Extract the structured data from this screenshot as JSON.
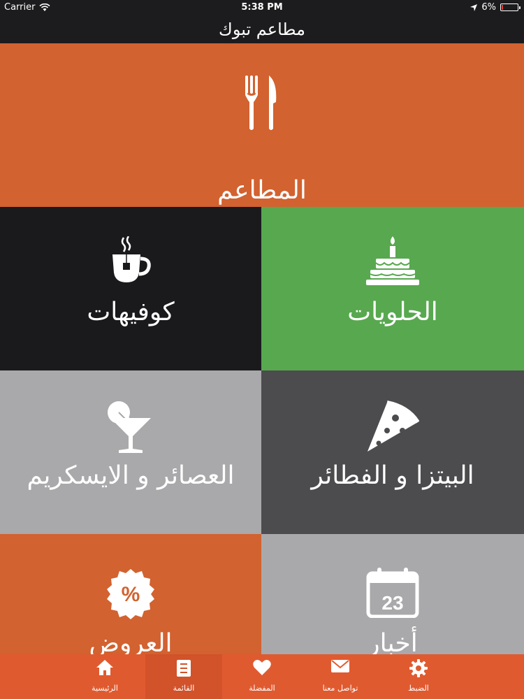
{
  "status_bar": {
    "carrier": "Carrier",
    "time": "5:38 PM",
    "battery": "6%",
    "battery_level": 0.06
  },
  "navbar": {
    "title": "مطاعم تبوك"
  },
  "tiles": {
    "restaurants": {
      "label": "المطاعم",
      "icon": "fork-knife-icon"
    },
    "cafes": {
      "label": "كوفيهات",
      "icon": "tea-cup-icon"
    },
    "sweets": {
      "label": "الحلويات",
      "icon": "cake-icon"
    },
    "juices": {
      "label": "العصائر و الايسكريم",
      "icon": "cocktail-icon"
    },
    "pizza": {
      "label": "البيتزا و الفطائر",
      "icon": "pizza-icon"
    },
    "offers": {
      "label": "العروض",
      "icon": "percent-badge-icon"
    },
    "news": {
      "label": "أخبار",
      "icon": "calendar-icon",
      "calendar_day": "23"
    }
  },
  "tabbar": {
    "items": [
      {
        "label": "الرئيسية",
        "icon": "home-icon"
      },
      {
        "label": "القائمة",
        "icon": "list-icon",
        "selected": true
      },
      {
        "label": "المفضلة",
        "icon": "heart-icon"
      },
      {
        "label": "تواصل معنا",
        "icon": "mail-icon"
      },
      {
        "label": "الضبط",
        "icon": "gear-icon"
      }
    ]
  },
  "colors": {
    "orange": "#d26230",
    "green": "#58a84f",
    "dark": "#1a1a1d",
    "gray_light": "#a9a9ab",
    "gray_dark": "#4c4c4f",
    "tabbar": "#e05a30"
  }
}
